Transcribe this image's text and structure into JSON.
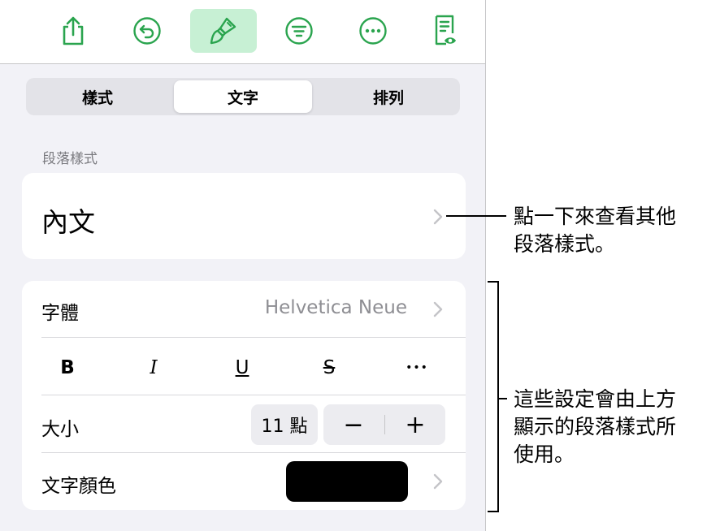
{
  "toolbar": {
    "icons": [
      "share-icon",
      "undo-icon",
      "format-brush-icon",
      "organize-icon",
      "more-icon",
      "reading-view-icon"
    ],
    "active": "format-brush-icon",
    "accent_color": "#2aa44e",
    "active_bg": "#c7f0d4"
  },
  "tabs": [
    {
      "label": "樣式",
      "active": false
    },
    {
      "label": "文字",
      "active": true
    },
    {
      "label": "排列",
      "active": false
    }
  ],
  "paragraph_style": {
    "section_label": "段落樣式",
    "value": "內文"
  },
  "font": {
    "label": "字體",
    "value": "Helvetica Neue",
    "bold": "B",
    "italic": "I",
    "underline": "U",
    "strikethrough": "S",
    "more": "•••",
    "size_label": "大小",
    "size_value": "11 點",
    "decrement": "−",
    "increment": "+",
    "color_label": "文字顏色",
    "color_value": "#000000"
  },
  "callouts": {
    "paragraph": [
      "點一下來查看其他",
      "段落樣式。"
    ],
    "settings": [
      "這些設定會由上方",
      "顯示的段落樣式所",
      "使用。"
    ]
  }
}
